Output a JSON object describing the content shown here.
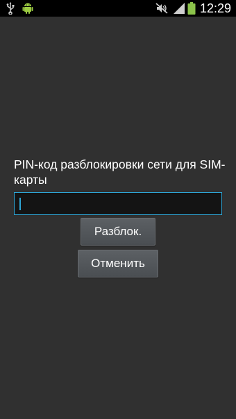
{
  "status_bar": {
    "time": "12:29",
    "icons": [
      "usb-icon",
      "android-icon",
      "mute-icon",
      "signal-icon",
      "battery-icon"
    ],
    "battery_color": "#8bc34a"
  },
  "dialog": {
    "prompt": "PIN-код разблокировки сети для SIM-карты",
    "pin_value": "",
    "unlock_label": "Разблок.",
    "cancel_label": "Отменить"
  },
  "colors": {
    "background": "#303030",
    "accent": "#2ea6d6"
  }
}
